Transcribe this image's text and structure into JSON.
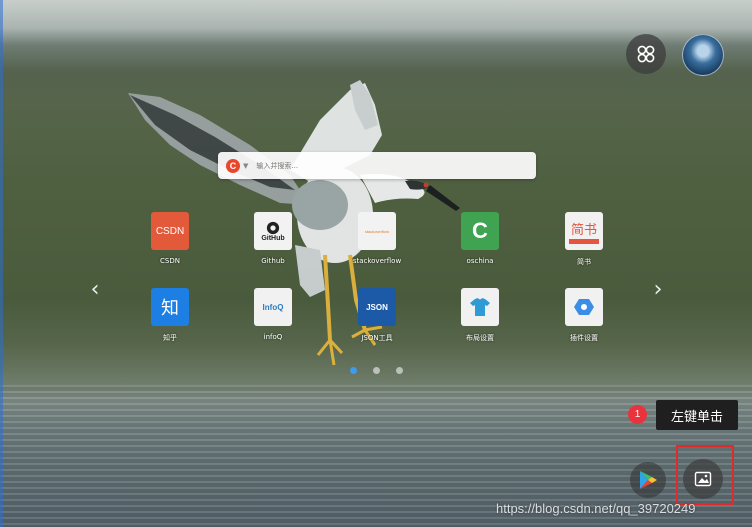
{
  "search": {
    "engine_letter": "C",
    "placeholder": "输入并搜索...",
    "value": ""
  },
  "navigation": {
    "prev_arrow": "‹",
    "next_arrow": "›",
    "pages": 3,
    "active_page": 1
  },
  "shortcuts": [
    {
      "label": "CSDN",
      "icon_text": "CSDN",
      "color": "#e25a3a",
      "icon": "csdn-icon"
    },
    {
      "label": "Github",
      "icon_text": "GitHub",
      "color": "#f2f2f2",
      "icon": "github-icon"
    },
    {
      "label": "stackoverflow",
      "icon_text": "stackoverflow",
      "color": "#f2f2f2",
      "icon": "stackoverflow-icon"
    },
    {
      "label": "oschina",
      "icon_text": "C",
      "color": "#3fa351",
      "icon": "oschina-icon"
    },
    {
      "label": "简书",
      "icon_text": "简书",
      "color": "#f1f1f1",
      "icon": "jianshu-icon"
    },
    {
      "label": "知乎",
      "icon_text": "知",
      "color": "#1d7fe3",
      "icon": "zhihu-icon"
    },
    {
      "label": "infoQ",
      "icon_text": "InfoQ",
      "color": "#f1f1f1",
      "icon": "infoq-icon"
    },
    {
      "label": "JSON工具",
      "icon_text": "JSON",
      "color": "#1c5aa8",
      "icon": "json-icon"
    },
    {
      "label": "布局设置",
      "icon_text": "",
      "color": "#f1f1f1",
      "icon": "shirt-icon"
    },
    {
      "label": "插件设置",
      "icon_text": "",
      "color": "#f1f1f1",
      "icon": "plugin-icon"
    }
  ],
  "tooltip": {
    "step": "1",
    "text": "左键单击"
  },
  "watermark": "https://blog.csdn.net/qq_39720249",
  "colors": {
    "accent_dot": "#3d9bf0",
    "highlight": "#e22a2a"
  }
}
